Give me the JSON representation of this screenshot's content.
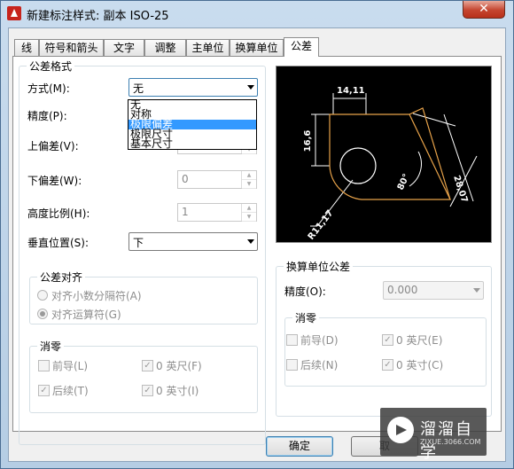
{
  "window": {
    "title": "新建标注样式: 副本 ISO-25",
    "close": "✕"
  },
  "tabs": [
    "线",
    "符号和箭头",
    "文字",
    "调整",
    "主单位",
    "换算单位",
    "公差"
  ],
  "tolerance_format": {
    "legend": "公差格式",
    "method_label": "方式(M):",
    "method_value": "无",
    "method_options": [
      "无",
      "对称",
      "极限偏差",
      "极限尺寸",
      "基本尺寸"
    ],
    "method_highlight": "极限偏差",
    "precision_label": "精度(P):",
    "upper_label": "上偏差(V):",
    "lower_label": "下偏差(W):",
    "lower_value": "0",
    "height_label": "高度比例(H):",
    "height_value": "1",
    "vpos_label": "垂直位置(S):",
    "vpos_value": "下"
  },
  "alignment": {
    "legend": "公差对齐",
    "opt1": "对齐小数分隔符(A)",
    "opt2": "对齐运算符(G)"
  },
  "zero_left": {
    "legend": "消零",
    "leading": "前导(L)",
    "trailing": "后续(T)",
    "feet": "0 英尺(F)",
    "inches": "0 英寸(I)"
  },
  "alt_units": {
    "legend": "换算单位公差",
    "precision_label": "精度(O):",
    "precision_value": "0.000"
  },
  "zero_right": {
    "legend": "消零",
    "leading": "前导(D)",
    "trailing": "后续(N)",
    "feet": "0 英尺(E)",
    "inches": "0 英寸(C)"
  },
  "preview": {
    "dim_top": "14,11",
    "dim_left": "16,6",
    "dim_right": "28,07",
    "dim_angle": "80°",
    "dim_radius": "R11,17"
  },
  "buttons": {
    "ok": "确定",
    "cancel": "取"
  },
  "watermark": {
    "title": "溜溜自学",
    "url": "ZIXUE.3066.COM"
  }
}
